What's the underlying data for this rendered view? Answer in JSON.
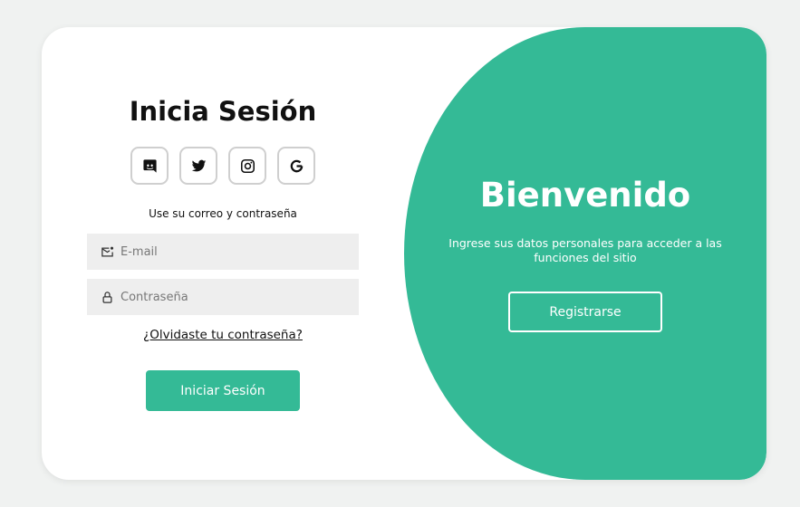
{
  "login": {
    "title": "Inicia Sesión",
    "social_buttons": [
      {
        "icon": "discord-icon"
      },
      {
        "icon": "twitter-icon"
      },
      {
        "icon": "instagram-icon"
      },
      {
        "icon": "google-icon"
      }
    ],
    "hint": "Use su correo y contraseña",
    "email": {
      "placeholder": "E-mail",
      "value": ""
    },
    "password": {
      "placeholder": "Contraseña",
      "value": ""
    },
    "forgot_label": "¿Olvidaste tu contraseña?",
    "submit_label": "Iniciar Sesión"
  },
  "welcome": {
    "title": "Bienvenido",
    "subtitle": "Ingrese sus datos personales para acceder a las funciones del sitio",
    "register_label": "Registrarse"
  },
  "colors": {
    "accent": "#34ba96",
    "background": "#f0f2f1",
    "input_bg": "#eeeeee"
  }
}
